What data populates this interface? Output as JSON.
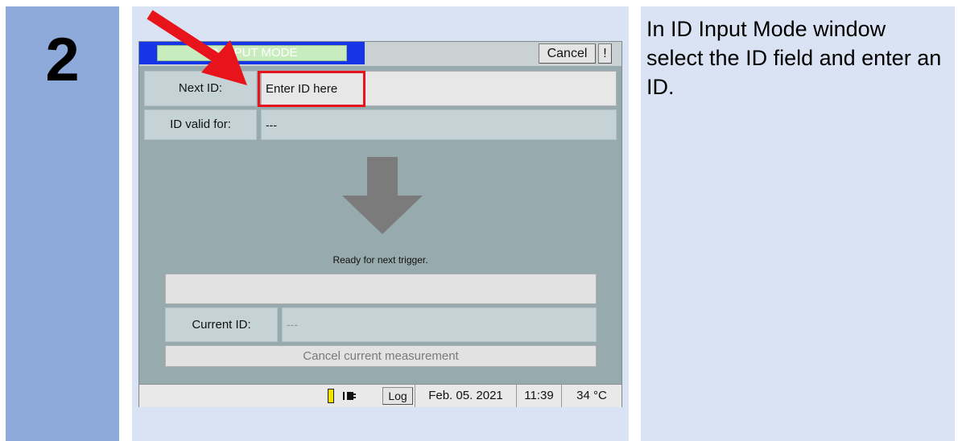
{
  "step": {
    "number": "2"
  },
  "description": "In ID Input Mode window select the ID field and enter an ID.",
  "window": {
    "title": "ID INPUT MODE",
    "cancel_label": "Cancel",
    "alert_label": "!"
  },
  "form": {
    "next_id_label": "Next ID:",
    "next_id_placeholder": "Enter ID here",
    "valid_for_label": "ID valid for:",
    "valid_for_value": "---",
    "ready_message": "Ready for next trigger.",
    "current_id_label": "Current ID:",
    "current_id_value": "---",
    "cancel_measurement_label": "Cancel current measurement"
  },
  "statusbar": {
    "log_label": "Log",
    "date": "Feb. 05. 2021",
    "time": "11:39",
    "temperature": "34 °C"
  },
  "icons": [
    "battery-icon",
    "power-plug-icon",
    "down-arrow-icon",
    "red-pointer-arrow"
  ],
  "colors": {
    "step_column": "#8eaadb",
    "panel_background": "#dae3f3",
    "screen_background": "#97aaad",
    "title_blue": "#1634e8",
    "highlight_red": "#e8141b"
  }
}
